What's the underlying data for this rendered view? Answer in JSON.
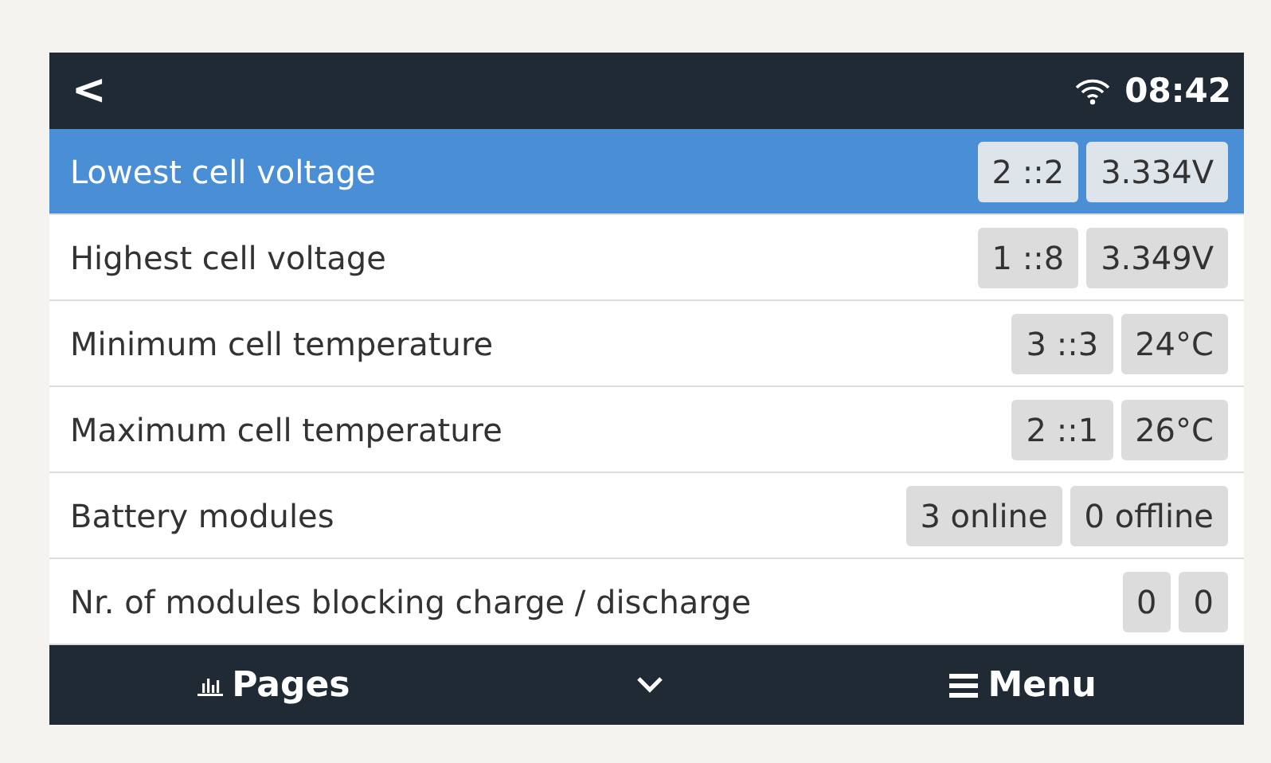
{
  "header": {
    "back": "<",
    "time": "08:42"
  },
  "rows": [
    {
      "label": "Lowest cell voltage",
      "selected": true,
      "values": [
        "2 ::2",
        "3.334V"
      ]
    },
    {
      "label": "Highest cell voltage",
      "selected": false,
      "values": [
        "1 ::8",
        "3.349V"
      ]
    },
    {
      "label": "Minimum cell temperature",
      "selected": false,
      "values": [
        "3 ::3",
        "24°C"
      ]
    },
    {
      "label": "Maximum cell temperature",
      "selected": false,
      "values": [
        "2 ::1",
        "26°C"
      ]
    },
    {
      "label": "Battery modules",
      "selected": false,
      "values": [
        "3 online",
        "0 offline"
      ]
    },
    {
      "label": "Nr. of modules blocking charge / discharge",
      "selected": false,
      "values": [
        "0",
        "0"
      ]
    }
  ],
  "footer": {
    "pages": "Pages",
    "menu": "Menu"
  }
}
